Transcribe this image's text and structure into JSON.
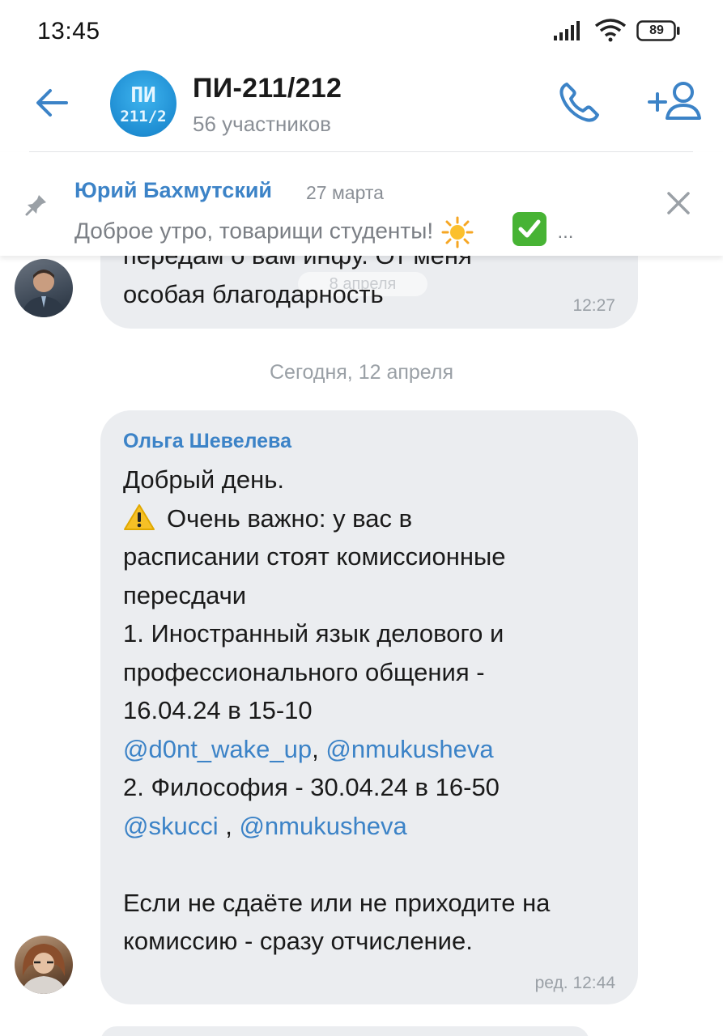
{
  "status_bar": {
    "time": "13:45",
    "battery": "89",
    "icons": [
      "signal-icon",
      "wifi-icon",
      "battery-icon"
    ]
  },
  "header": {
    "back_icon": "arrow-left-icon",
    "avatar": {
      "line1": "ПИ",
      "line2": "211/2"
    },
    "title": "ПИ-211/212",
    "subtitle": "56 участников",
    "call_icon": "phone-icon",
    "add_member_icon": "add-user-icon"
  },
  "pinned": {
    "author": "Юрий Бахмутский",
    "date": "27 марта",
    "text": "Доброе утро, товарищи студенты!",
    "ellipsis": "..."
  },
  "previous_message": {
    "clipped_line": "передам о вам инфу. От меня",
    "text": "особая благодарность",
    "ghost_date": "8 апреля",
    "time": "12:27"
  },
  "date_separator": "Сегодня, 12 апреля",
  "message": {
    "sender": "Ольга Шевелева",
    "lines": {
      "l1": "Добрый день.",
      "l2": "Очень важно: у вас в",
      "l3": "расписании стоят комиссионные",
      "l4": "пересдачи",
      "l5": "1. Иностранный язык делового и",
      "l6": "профессионального общения -",
      "l7": "16.04.24 в 15-10",
      "m1": "@d0nt_wake_up",
      "sep1": ", ",
      "m2": "@nmukusheva",
      "l9": "2. Философия - 30.04.24 в 16-50",
      "m3": "@skucci",
      "sep2": " , ",
      "m4": "@nmukusheva",
      "l12": "Если не сдаёте или не приходите на",
      "l13": "комиссию - сразу отчисление."
    },
    "time": "ред. 12:44"
  },
  "colors": {
    "accent": "#3c83c7",
    "bubble": "#ebedf0",
    "muted": "#9aa0a6"
  }
}
